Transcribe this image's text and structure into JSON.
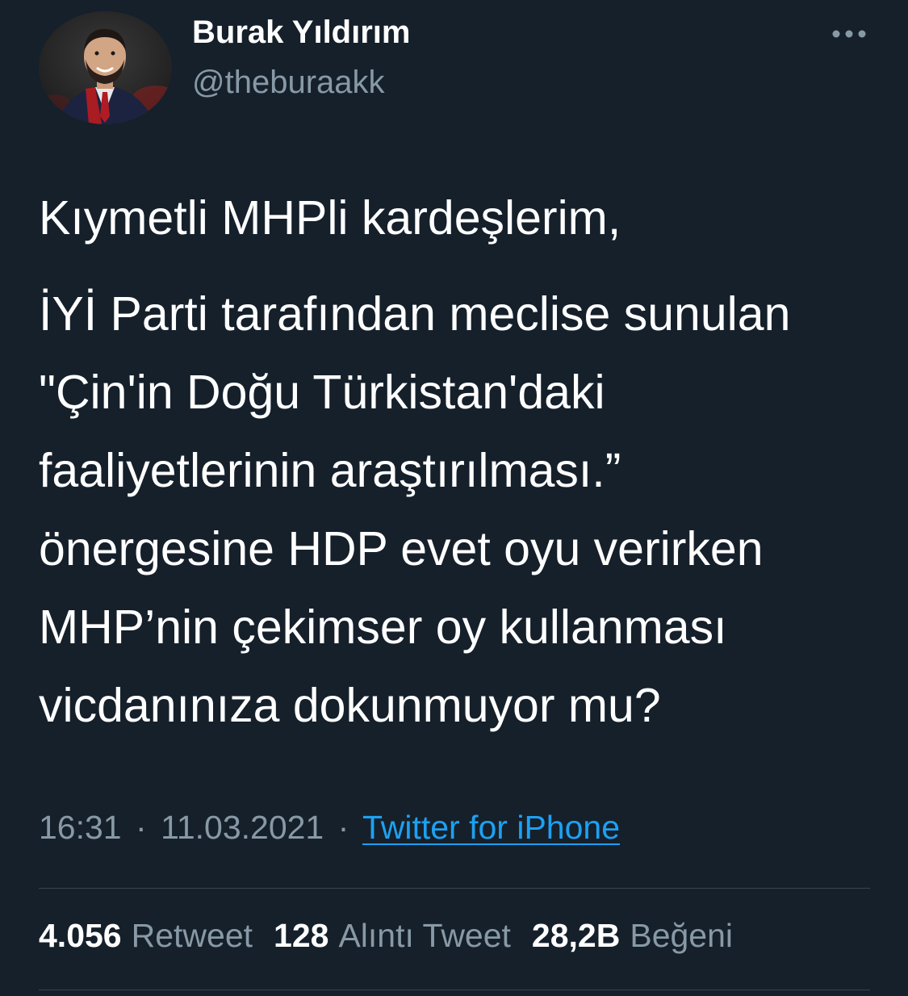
{
  "author": {
    "name": "Burak Yıldırım",
    "handle": "@theburaakk",
    "avatar_icon": "profile-photo"
  },
  "more_icon": "more-horizontal-icon",
  "tweet": {
    "paragraphs": [
      "Kıymetli MHPli kardeşlerim,",
      "İYİ Parti tarafından meclise sunulan\n\"Çin'in Doğu Türkistan'daki\nfaaliyetlerinin araştırılması.”\nönergesine HDP evet oyu verirken\nMHP’nin çekimser oy kullanması\nvicdanınıza dokunmuyor mu?"
    ],
    "time": "16:31",
    "date": "11.03.2021",
    "separator": "·",
    "source": "Twitter for iPhone"
  },
  "stats": [
    {
      "count": "4.056",
      "label": "Retweet"
    },
    {
      "count": "128",
      "label": "Alıntı Tweet"
    },
    {
      "count": "28,2B",
      "label": "Beğeni"
    }
  ],
  "colors": {
    "background": "#15202b",
    "text": "#ffffff",
    "secondary": "#8899a6",
    "link": "#1da1f2",
    "divider": "#38444d"
  }
}
